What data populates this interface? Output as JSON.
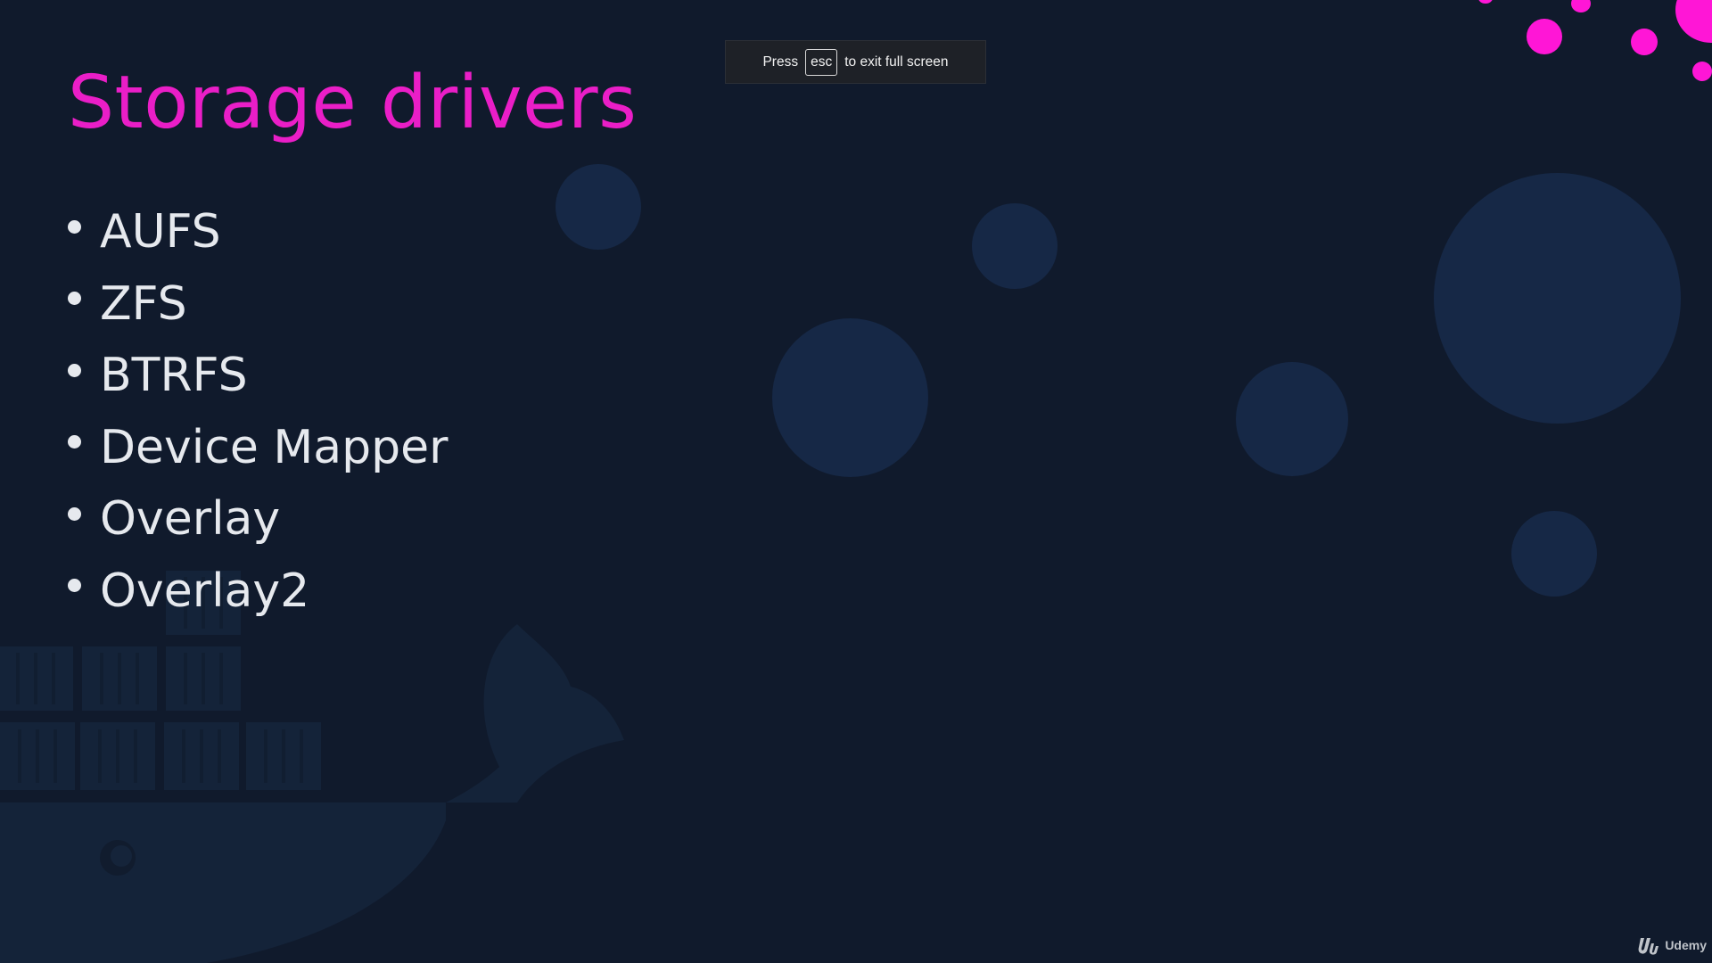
{
  "slide": {
    "title": "Storage drivers",
    "bullets": [
      "AUFS",
      "ZFS",
      "BTRFS",
      "Device Mapper",
      "Overlay",
      "Overlay2"
    ]
  },
  "fullscreen_notice": {
    "prefix": "Press",
    "key": "esc",
    "suffix": "to exit full screen"
  },
  "brand": {
    "name": "Udemy",
    "icon": "udemy-logo-icon"
  },
  "colors": {
    "background": "#101a2c",
    "title": "#ea1ec7",
    "bullet_text": "#e6e9ee",
    "accent_dots": "#ff16d6",
    "decor_circles": "#162846"
  }
}
